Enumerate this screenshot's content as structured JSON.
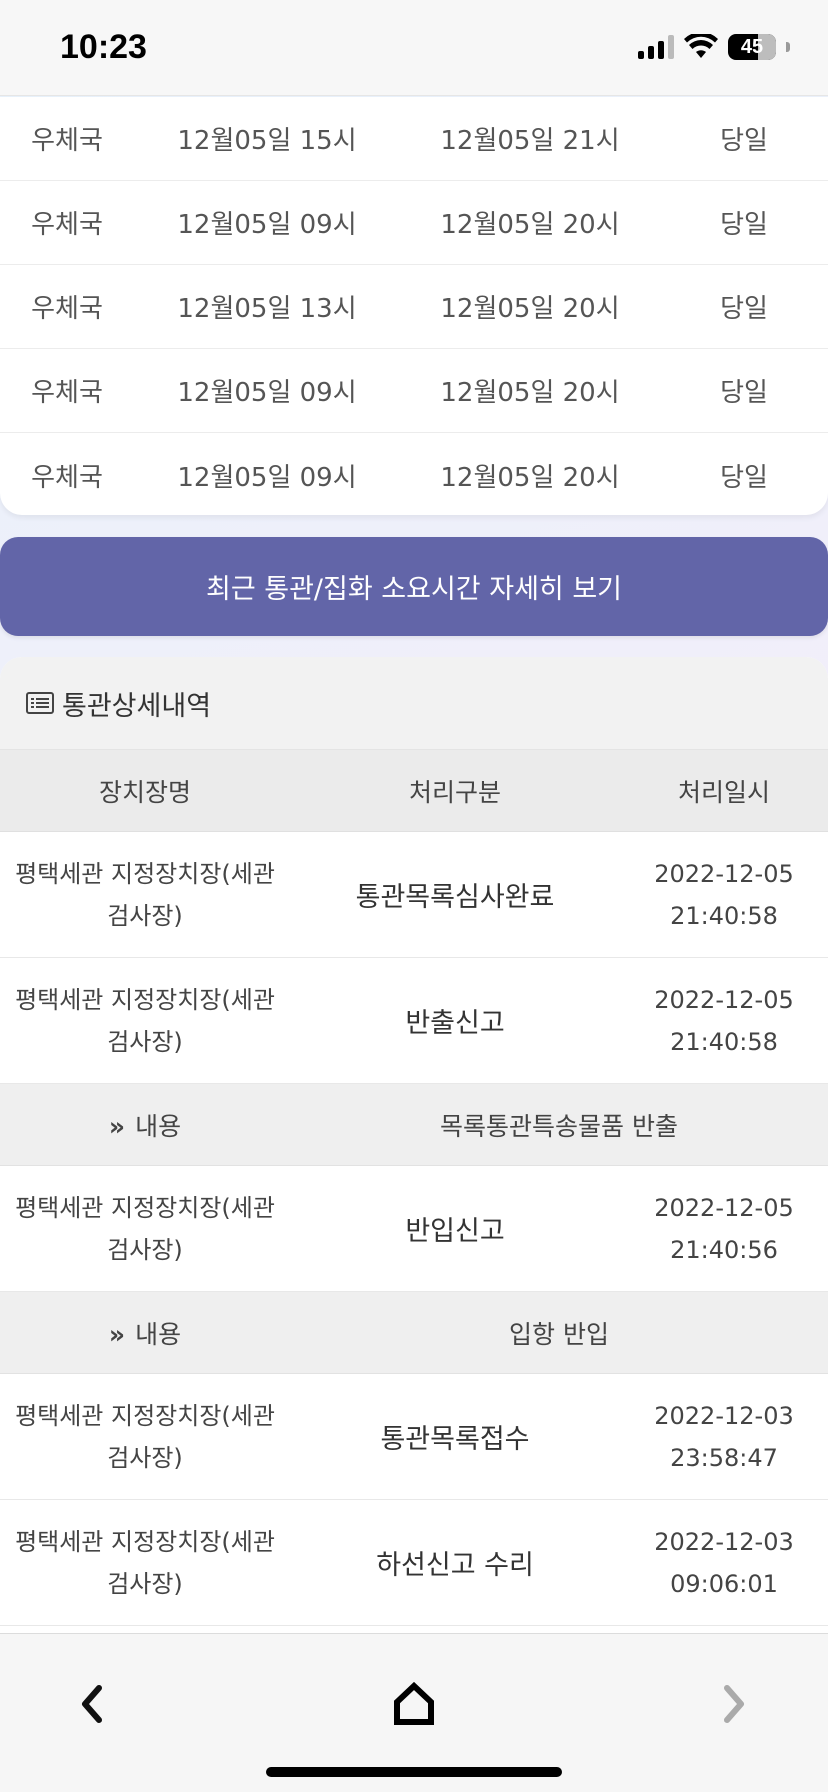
{
  "status_bar": {
    "time": "10:23",
    "battery": "45"
  },
  "carrier_table": {
    "rows": [
      {
        "carrier": "우체국",
        "start": "12월05일 15시",
        "end": "12월05일 21시",
        "duration": "당일"
      },
      {
        "carrier": "우체국",
        "start": "12월05일 09시",
        "end": "12월05일 20시",
        "duration": "당일"
      },
      {
        "carrier": "우체국",
        "start": "12월05일 13시",
        "end": "12월05일 20시",
        "duration": "당일"
      },
      {
        "carrier": "우체국",
        "start": "12월05일 09시",
        "end": "12월05일 20시",
        "duration": "당일"
      },
      {
        "carrier": "우체국",
        "start": "12월05일 09시",
        "end": "12월05일 20시",
        "duration": "당일"
      }
    ]
  },
  "detail_button": {
    "label": "최근 통관/집화 소요시간 자세히 보기"
  },
  "detail_panel": {
    "title": "통관상세내역",
    "columns": {
      "location": "장치장명",
      "type": "처리구분",
      "datetime": "처리일시"
    },
    "memo_label": "내용",
    "records": [
      {
        "location": "평택세관 지정장치장(세관 검사장)",
        "type": "통관목록심사완료",
        "date": "2022-12-05",
        "time": "21:40:58",
        "memo": ""
      },
      {
        "location": "평택세관 지정장치장(세관 검사장)",
        "type": "반출신고",
        "date": "2022-12-05",
        "time": "21:40:58",
        "memo": "목록통관특송물품 반출"
      },
      {
        "location": "평택세관 지정장치장(세관 검사장)",
        "type": "반입신고",
        "date": "2022-12-05",
        "time": "21:40:56",
        "memo": "입항 반입"
      },
      {
        "location": "평택세관 지정장치장(세관 검사장)",
        "type": "통관목록접수",
        "date": "2022-12-03",
        "time": "23:58:47",
        "memo": ""
      },
      {
        "location": "평택세관 지정장치장(세관 검사장)",
        "type": "하선신고 수리",
        "date": "2022-12-03",
        "time": "09:06:01",
        "memo": ""
      }
    ]
  },
  "toolbar": {
    "back_icon": "chevron-left-icon",
    "home_icon": "home-icon",
    "forward_icon": "chevron-right-icon",
    "forward_disabled": true
  }
}
